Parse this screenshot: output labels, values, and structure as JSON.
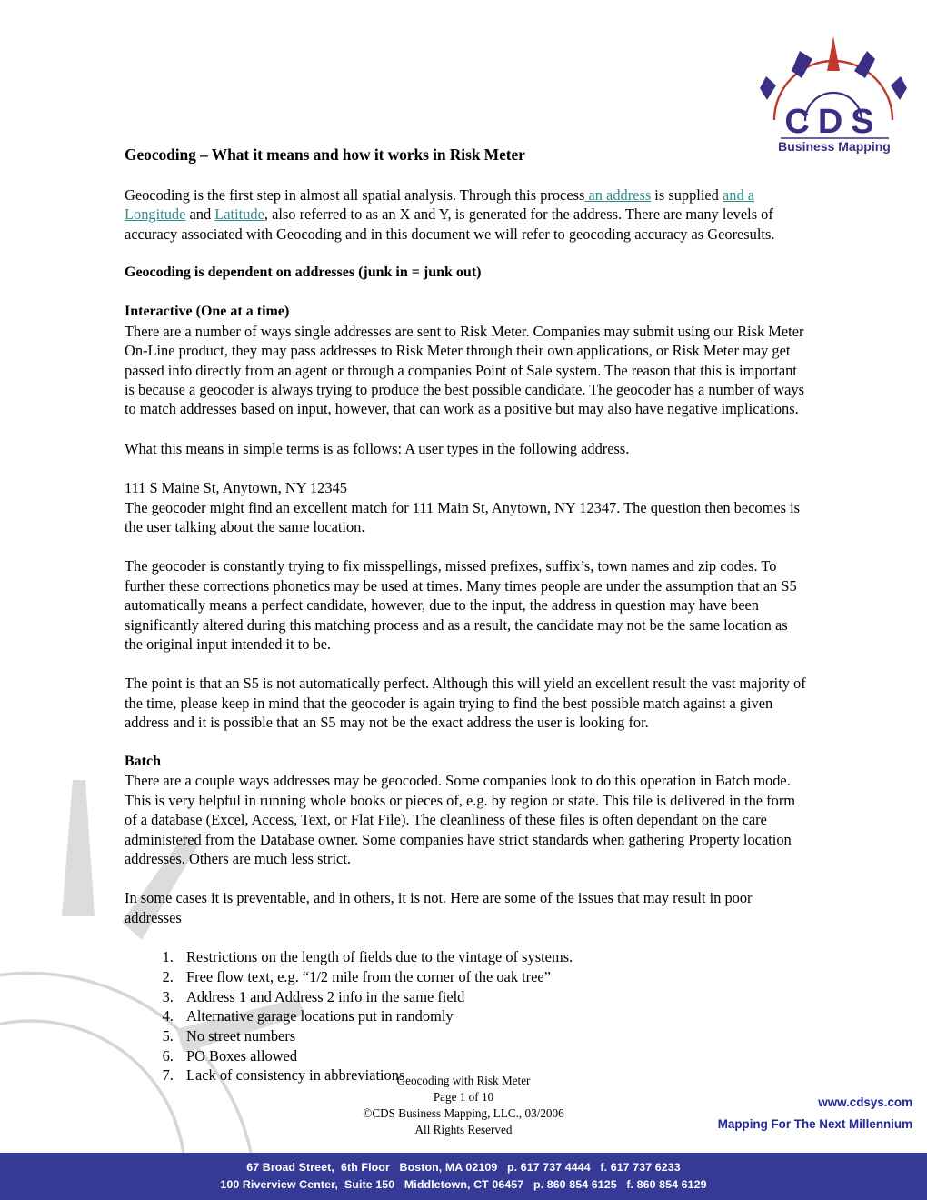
{
  "logo": {
    "name": "cds-business-mapping-logo",
    "wordmark": "CDS",
    "tagline": "Business Mapping",
    "colors": {
      "letters": "#3b2f85",
      "arc": "#c0392b",
      "rays": "#3b2f85"
    }
  },
  "document": {
    "title": "Geocoding – What it means and how it works in Risk Meter",
    "intro": {
      "seg1": "Geocoding is the first step in almost all spatial analysis.  Through this process",
      "ins1": " an address",
      "seg2": " is supplied ",
      "ins2": "and a Longitude",
      "seg3": " and ",
      "ins3": "Latitude",
      "seg4": ", also referred to as an X and Y, is generated for the address.  There are many levels of accuracy associated with Geocoding and in this document we will refer to geocoding accuracy as Georesults."
    },
    "heading_dependent": "Geocoding is dependent on addresses (junk in = junk out)",
    "heading_interactive": "Interactive (One at a time)",
    "para_interactive": "There are a number of ways single addresses are sent to Risk Meter.  Companies may submit using our Risk Meter On-Line product, they may pass addresses to Risk Meter through their own applications, or Risk Meter may get passed info directly from an agent or through a companies Point of Sale system.  The reason that this is important is because a geocoder is always trying to produce the best possible candidate.  The geocoder has a number of ways to match addresses based on input, however, that can work as a positive but may also have negative implications.",
    "para_simple_terms": "What this means in simple terms is as follows:  A user types in the following address.",
    "example_address": "111 S Maine St, Anytown, NY 12345",
    "para_example_result": "The geocoder might find an excellent match for 111 Main St, Anytown, NY 12347.  The question then becomes is the user talking about the same location.",
    "para_misspellings": "The geocoder is constantly trying to fix misspellings, missed prefixes, suffix’s, town names and zip codes.  To further these corrections phonetics may be used at times.  Many times people are under the assumption that an S5 automatically means a perfect candidate, however, due to the input, the address in question may have been significantly altered during this matching process and as a result, the candidate may not be the same location as the original input intended it to be.",
    "para_s5_point": "The point is that an S5 is not automatically perfect.  Although this will yield an excellent result the vast majority of the time, please keep in mind that the geocoder is again trying to find the best possible match against a given address and it is possible that an S5 may not be the exact address the user is looking for.",
    "heading_batch": "Batch",
    "para_batch": "There are a couple ways addresses may be geocoded.  Some companies look to do this operation in Batch mode.  This is very helpful in running whole books or pieces of, e.g. by region or state.  This file is delivered in the form of a database (Excel, Access, Text, or Flat File).  The cleanliness of these files is often dependant on the care administered from the Database owner.  Some companies have strict standards when gathering Property location addresses.  Others are much less strict.",
    "para_preventable": "In some cases it is preventable, and in others, it is not. Here are some of the issues that may result in poor addresses",
    "issues": [
      "Restrictions on the length of fields due to the vintage of systems.",
      "Free flow text, e.g. “1/2 mile from the corner of the oak tree”",
      "Address 1 and Address 2 info in the same field",
      "Alternative garage locations put in randomly",
      "No street numbers",
      "PO Boxes allowed",
      "Lack of consistency in abbreviations"
    ]
  },
  "footer": {
    "doc_name": "Geocoding with Risk Meter",
    "page_number": "Page 1 of 10",
    "copyright": "©CDS Business Mapping, LLC., 03/2006",
    "rights": "All Rights Reserved",
    "website": "www.cdsys.com",
    "tagline": "Mapping For The Next Millennium"
  },
  "bottom_bar": {
    "background": "#343a96",
    "line1": "67 Broad Street,  6th Floor   Boston, MA 02109   p. 617 737 4444   f. 617 737 6233",
    "line2": "100 Riverview Center,  Suite 150   Middletown, CT 06457   p. 860 854 6125   f. 860 854 6129"
  }
}
